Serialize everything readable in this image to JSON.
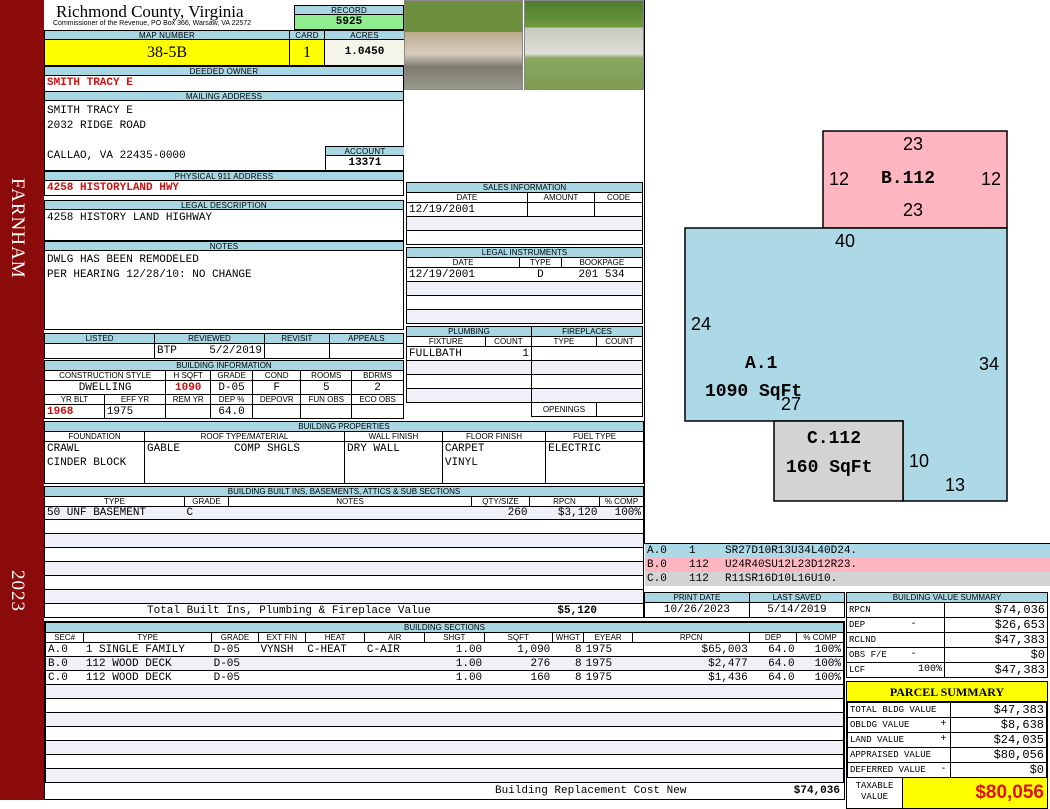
{
  "sidebar": {
    "district": "FARNHAM",
    "year": "2023",
    "color": "#8b0a0a"
  },
  "header": {
    "county": "Richmond County, Virginia",
    "office": "Commissioner of the Revenue, PO Box 366, Warsaw, VA 22572",
    "record_label": "RECORD",
    "record": "5925"
  },
  "parcel": {
    "map_label": "MAP NUMBER",
    "map": "38-5B",
    "card_label": "CARD",
    "card": "1",
    "acres_label": "ACRES",
    "acres": "1.0450"
  },
  "owner": {
    "label": "DEEDED OWNER",
    "name": "SMITH TRACY E"
  },
  "mailing": {
    "label": "MAILING ADDRESS",
    "line1": "SMITH TRACY E",
    "line2": "2032 RIDGE ROAD",
    "line3": "CALLAO, VA 22435-0000",
    "account_label": "ACCOUNT",
    "account": "13371"
  },
  "physical": {
    "label": "PHYSICAL 911 ADDRESS",
    "address": "4258 HISTORYLAND HWY"
  },
  "legal": {
    "label": "LEGAL DESCRIPTION",
    "text": "4258 HISTORY LAND HIGHWAY"
  },
  "notes": {
    "label": "NOTES",
    "line1": "DWLG HAS BEEN REMODELED",
    "line2": "PER HEARING 12/28/10: NO CHANGE"
  },
  "review": {
    "listed_label": "LISTED",
    "reviewed_label": "REVIEWED",
    "revisit_label": "REVISIT",
    "appeals_label": "APPEALS",
    "listed": "",
    "reviewed_by": "BTP",
    "reviewed_date": "5/2/2019",
    "revisit": "",
    "appeals": ""
  },
  "building_info": {
    "label": "BUILDING INFORMATION",
    "h": [
      "CONSTRUCTION STYLE",
      "H SQFT",
      "GRADE",
      "COND",
      "ROOMS",
      "BDRMS"
    ],
    "v": [
      "DWELLING",
      "1090",
      "D-05",
      "F",
      "5",
      "2"
    ],
    "h2": [
      "YR BLT",
      "EFF YR",
      "REM YR",
      "DEP %",
      "DEPOVR",
      "FUN OBS",
      "ECO OBS"
    ],
    "v2": [
      "1968",
      "1975",
      "",
      "64.0",
      "",
      "",
      ""
    ]
  },
  "sales": {
    "label": "SALES INFORMATION",
    "h": [
      "DATE",
      "AMOUNT",
      "CODE"
    ],
    "rows": [
      [
        "12/19/2001",
        "",
        ""
      ]
    ]
  },
  "instruments": {
    "label": "LEGAL INSTRUMENTS",
    "h": [
      "DATE",
      "TYPE",
      "BOOKPAGE"
    ],
    "rows": [
      [
        "12/19/2001",
        "D",
        "201 534"
      ]
    ]
  },
  "plumbing": {
    "label": "PLUMBING",
    "h": [
      "FIXTURE",
      "COUNT"
    ],
    "rows": [
      [
        "FULLBATH",
        "1"
      ]
    ]
  },
  "fireplaces": {
    "label": "FIREPLACES",
    "h": [
      "TYPE",
      "COUNT"
    ],
    "openings_label": "OPENINGS"
  },
  "properties": {
    "label": "BUILDING PROPERTIES",
    "h": [
      "FOUNDATION",
      "ROOF TYPE/MATERIAL",
      "WALL FINISH",
      "FLOOR FINISH",
      "FUEL TYPE"
    ],
    "foundation": [
      "CRAWL",
      "CINDER BLOCK"
    ],
    "roof_type": "GABLE",
    "roof_material": "COMP SHGLS",
    "wall": "DRY WALL",
    "floor": [
      "CARPET",
      "VINYL"
    ],
    "fuel": "ELECTRIC"
  },
  "builtins": {
    "label": "BUILDING BUILT INS, BASEMENTS, ATTICS & SUB SECTIONS",
    "h": [
      "TYPE",
      "GRADE",
      "NOTES",
      "QTY/SIZE",
      "RPCN",
      "% COMP"
    ],
    "rows": [
      [
        "50 UNF BASEMENT",
        "C",
        "",
        "260",
        "$3,120",
        "100%"
      ]
    ],
    "total_label": "Total Built Ins, Plumbing & Fireplace Value",
    "total": "$5,120"
  },
  "sections": {
    "label": "BUILDING SECTIONS",
    "h": [
      "SEC#",
      "TYPE",
      "GRADE",
      "EXT FIN",
      "HEAT",
      "AIR",
      "SHGT",
      "SQFT",
      "WHGT",
      "EYEAR",
      "RPCN",
      "DEP",
      "% COMP"
    ],
    "rows": [
      [
        "A.0",
        "1 SINGLE FAMILY",
        "D-05",
        "VYNSH",
        "C-HEAT",
        "C-AIR",
        "1.00",
        "1,090",
        "8",
        "1975",
        "$65,003",
        "64.0",
        "100%"
      ],
      [
        "B.0",
        "112 WOOD DECK",
        "D-05",
        "",
        "",
        "",
        "1.00",
        "276",
        "8",
        "1975",
        "$2,477",
        "64.0",
        "100%"
      ],
      [
        "C.0",
        "112 WOOD DECK",
        "D-05",
        "",
        "",
        "",
        "1.00",
        "160",
        "8",
        "1975",
        "$1,436",
        "64.0",
        "100%"
      ]
    ],
    "replacement_label": "Building Replacement Cost New",
    "replacement": "$74,036"
  },
  "sketch": {
    "colors": {
      "A": "#add8e6",
      "B": "#ffb6c1",
      "C": "#d3d3d3"
    },
    "labels": {
      "b_top": "23",
      "b_left": "12",
      "b_name": "B.112",
      "b_right": "12",
      "b_bottom": "23",
      "a_top": "40",
      "a_left": "24",
      "a_right": "34",
      "a_name": "A.1",
      "a_area": "1090 SqFt",
      "a_bottom": "27",
      "c_name": "C.112",
      "c_area": "160 SqFt",
      "c_right": "10",
      "a_br": "13"
    },
    "vectors": [
      [
        "A.0",
        "1",
        "SR27D10R13U34L40D24."
      ],
      [
        "B.0",
        "112",
        "U24R40SU12L23D12R23."
      ],
      [
        "C.0",
        "112",
        "R11SR16D10L16U10."
      ]
    ]
  },
  "dates": {
    "print_label": "PRINT DATE",
    "print": "10/26/2023",
    "saved_label": "LAST SAVED",
    "saved": "5/14/2019"
  },
  "value_summary": {
    "label": "BUILDING VALUE SUMMARY",
    "rows": [
      [
        "RPCN",
        "",
        "$74,036"
      ],
      [
        "DEP",
        "-",
        "$26,653"
      ],
      [
        "RCLND",
        "",
        "$47,383"
      ],
      [
        "OBS F/E",
        "-",
        "$0"
      ],
      [
        "LCF",
        "100%",
        "$47,383"
      ]
    ]
  },
  "parcel_summary": {
    "label": "PARCEL SUMMARY",
    "rows": [
      [
        "TOTAL BLDG VALUE",
        "",
        "$47,383"
      ],
      [
        "OBLDG VALUE",
        "+",
        "$8,638"
      ],
      [
        "LAND VALUE",
        "+",
        "$24,035"
      ],
      [
        "APPRAISED VALUE",
        "",
        "$80,056"
      ],
      [
        "DEFERRED VALUE",
        "-",
        "$0"
      ]
    ],
    "taxable_label1": "TAXABLE",
    "taxable_label2": "VALUE",
    "taxable": "$80,056"
  }
}
